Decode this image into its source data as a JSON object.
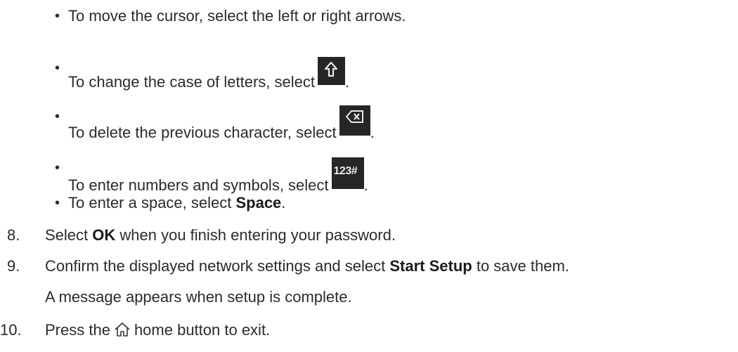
{
  "bullets": [
    {
      "text": "To move the cursor, select the left or right arrows."
    },
    {
      "text_before": "To change the case of letters, select",
      "text_after": ".",
      "icon": "shift-key-icon"
    },
    {
      "text_before": "To delete the previous character, select",
      "text_after": ".",
      "icon": "backspace-key-icon"
    },
    {
      "text_before": "To enter numbers and symbols, select",
      "text_after": ".",
      "icon": "number-symbol-key-icon",
      "icon_label": "123#"
    },
    {
      "text_before": "To enter a space, select ",
      "bold": "Space",
      "text_after": "."
    }
  ],
  "steps": [
    {
      "number": "8.",
      "text_before": "Select ",
      "bold": "OK",
      "text_after": " when you finish entering your password."
    },
    {
      "number": "9.",
      "text_before": "Confirm the displayed network settings and select ",
      "bold": "Start Setup",
      "text_after": " to save them.",
      "subtext": "A message appears when setup is complete."
    },
    {
      "number": "10.",
      "text_before": "Press the",
      "text_after": "home button to exit.",
      "icon": "home-icon"
    }
  ],
  "bullet_glyph": "•"
}
